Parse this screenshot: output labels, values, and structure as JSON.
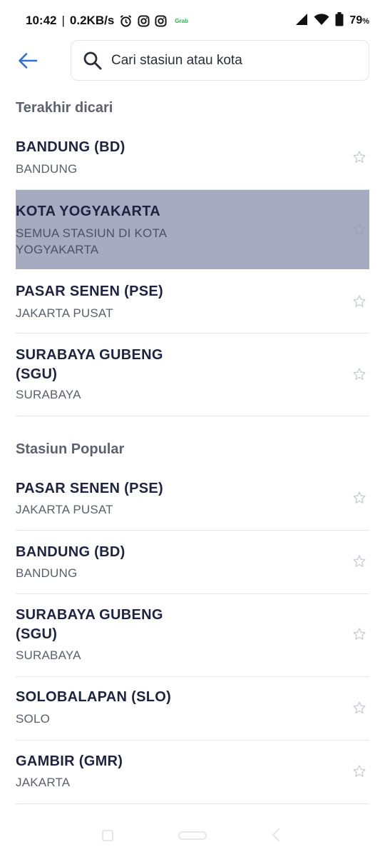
{
  "status_bar": {
    "time": "10:42",
    "separator": "|",
    "net_speed": "0.2KB/s",
    "battery_pct": "79",
    "battery_unit": "%",
    "app_mini_label": "Grab"
  },
  "header": {
    "search_placeholder": "Cari stasiun atau kota"
  },
  "recent": {
    "title": "Terakhir dicari",
    "items": [
      {
        "name": "BANDUNG (BD)",
        "sub": "BANDUNG"
      },
      {
        "name": "KOTA YOGYAKARTA",
        "sub": "SEMUA STASIUN DI KOTA YOGYAKARTA"
      },
      {
        "name": "PASAR SENEN (PSE)",
        "sub": "JAKARTA PUSAT"
      },
      {
        "name": "SURABAYA GUBENG (SGU)",
        "sub": "SURABAYA"
      }
    ]
  },
  "popular": {
    "title": "Stasiun Popular",
    "items": [
      {
        "name": "PASAR SENEN (PSE)",
        "sub": "JAKARTA PUSAT"
      },
      {
        "name": "BANDUNG (BD)",
        "sub": "BANDUNG"
      },
      {
        "name": "SURABAYA GUBENG (SGU)",
        "sub": "SURABAYA"
      },
      {
        "name": "SOLOBALAPAN (SLO)",
        "sub": "SOLO"
      },
      {
        "name": "GAMBIR (GMR)",
        "sub": "JAKARTA"
      }
    ]
  },
  "colors": {
    "accent": "#2f6fd6",
    "highlight_row": "#a6abbf",
    "title_text": "#1d2340"
  },
  "icons": {
    "back": "arrow-left-icon",
    "search": "search-icon",
    "favorite": "star-outline-icon"
  }
}
